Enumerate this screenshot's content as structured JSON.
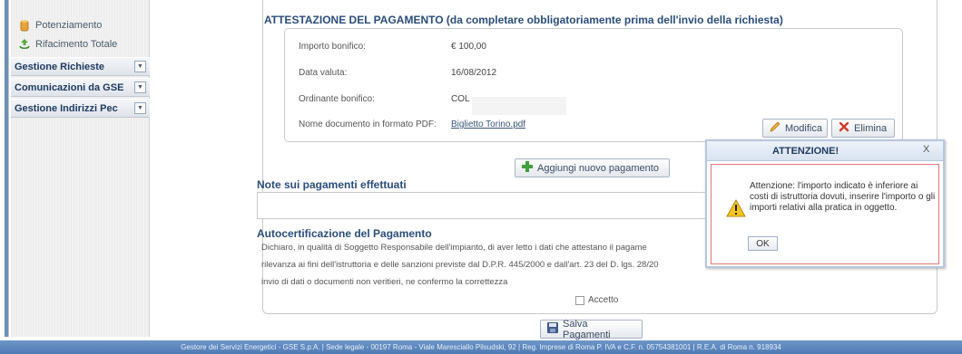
{
  "sidebar": {
    "links": [
      {
        "label": "Potenziamento",
        "icon": "cylinder-icon"
      },
      {
        "label": "Rifacimento Totale",
        "icon": "recycle-icon"
      }
    ],
    "groups": [
      {
        "label": "Gestione Richieste"
      },
      {
        "label": "Comunicazioni da GSE"
      },
      {
        "label": "Gestione Indirizzi Pec"
      }
    ]
  },
  "main": {
    "title": "ATTESTAZIONE DEL PAGAMENTO (da completare obbligatoriamente prima dell'invio della richiesta)",
    "payment": {
      "importo_label": "Importo bonifico:",
      "importo_value": "€ 100,00",
      "data_label": "Data valuta:",
      "data_value": "16/08/2012",
      "ordinante_label": "Ordinante bonifico:",
      "ordinante_value": "COL",
      "nome_label": "Nome documento in formato PDF:",
      "nome_value": "Biglietto Torino.pdf",
      "modifica_label": "Modifica",
      "elimina_label": "Elimina"
    },
    "add_payment_label": "Aggiungi nuovo pagamento",
    "notes_title": "Note sui pagamenti effettuati",
    "autocert_title": "Autocertificazione del Pagamento",
    "autocert_lines": [
      "Dichiaro, in qualità di Soggetto Responsabile dell'impianto, di aver letto i dati che attestano il pagame",
      "rilevanza ai fini dell'istruttoria e delle sanzioni previste dal D.P.R. 445/2000 e dall'art. 23 del D. lgs. 28/20",
      "invio di dati o documenti non veritieri, ne confermo la correttezza"
    ],
    "accetto_label": "Accetto",
    "save_label": "Salva Pagamenti"
  },
  "dialog": {
    "title": "ATTENZIONE!",
    "close": "X",
    "message": "Attenzione: l'importo indicato è inferiore ai costi di istruttoria dovuti, inserire l'importo o gli importi relativi alla pratica in oggetto.",
    "ok_label": "OK"
  },
  "footer": {
    "text": "Gestore dei Servizi Energetici - GSE S.p.A. | Sede legale - 00197 Roma - Viale Maresciallo Pilsudski, 92 | Reg. Imprese di Roma P. IVA e C.F. n. 05754381001 | R.E.A. di Roma n. 918934"
  },
  "colors": {
    "accent": "#2b4d7a",
    "footer": "#5b86bd",
    "dialog_border": "#e07878"
  }
}
